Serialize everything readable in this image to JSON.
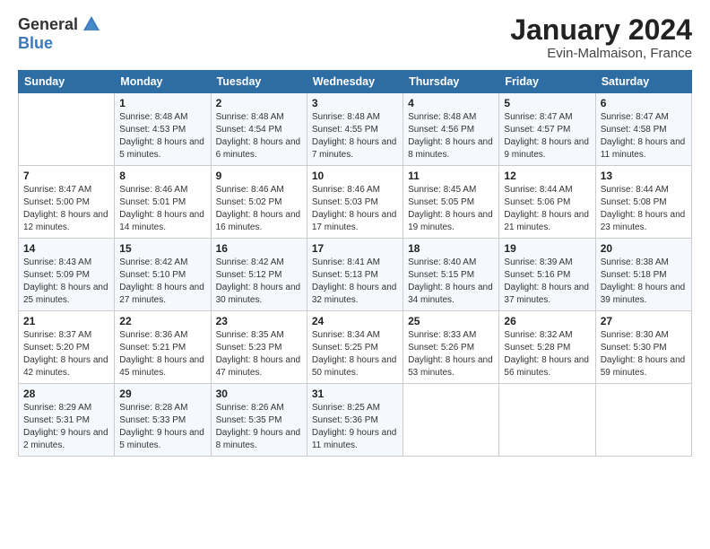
{
  "logo": {
    "general": "General",
    "blue": "Blue"
  },
  "header": {
    "title": "January 2024",
    "subtitle": "Evin-Malmaison, France"
  },
  "weekdays": [
    "Sunday",
    "Monday",
    "Tuesday",
    "Wednesday",
    "Thursday",
    "Friday",
    "Saturday"
  ],
  "weeks": [
    [
      {
        "day": "",
        "sunrise": "",
        "sunset": "",
        "daylight": ""
      },
      {
        "day": "1",
        "sunrise": "Sunrise: 8:48 AM",
        "sunset": "Sunset: 4:53 PM",
        "daylight": "Daylight: 8 hours and 5 minutes."
      },
      {
        "day": "2",
        "sunrise": "Sunrise: 8:48 AM",
        "sunset": "Sunset: 4:54 PM",
        "daylight": "Daylight: 8 hours and 6 minutes."
      },
      {
        "day": "3",
        "sunrise": "Sunrise: 8:48 AM",
        "sunset": "Sunset: 4:55 PM",
        "daylight": "Daylight: 8 hours and 7 minutes."
      },
      {
        "day": "4",
        "sunrise": "Sunrise: 8:48 AM",
        "sunset": "Sunset: 4:56 PM",
        "daylight": "Daylight: 8 hours and 8 minutes."
      },
      {
        "day": "5",
        "sunrise": "Sunrise: 8:47 AM",
        "sunset": "Sunset: 4:57 PM",
        "daylight": "Daylight: 8 hours and 9 minutes."
      },
      {
        "day": "6",
        "sunrise": "Sunrise: 8:47 AM",
        "sunset": "Sunset: 4:58 PM",
        "daylight": "Daylight: 8 hours and 11 minutes."
      }
    ],
    [
      {
        "day": "7",
        "sunrise": "Sunrise: 8:47 AM",
        "sunset": "Sunset: 5:00 PM",
        "daylight": "Daylight: 8 hours and 12 minutes."
      },
      {
        "day": "8",
        "sunrise": "Sunrise: 8:46 AM",
        "sunset": "Sunset: 5:01 PM",
        "daylight": "Daylight: 8 hours and 14 minutes."
      },
      {
        "day": "9",
        "sunrise": "Sunrise: 8:46 AM",
        "sunset": "Sunset: 5:02 PM",
        "daylight": "Daylight: 8 hours and 16 minutes."
      },
      {
        "day": "10",
        "sunrise": "Sunrise: 8:46 AM",
        "sunset": "Sunset: 5:03 PM",
        "daylight": "Daylight: 8 hours and 17 minutes."
      },
      {
        "day": "11",
        "sunrise": "Sunrise: 8:45 AM",
        "sunset": "Sunset: 5:05 PM",
        "daylight": "Daylight: 8 hours and 19 minutes."
      },
      {
        "day": "12",
        "sunrise": "Sunrise: 8:44 AM",
        "sunset": "Sunset: 5:06 PM",
        "daylight": "Daylight: 8 hours and 21 minutes."
      },
      {
        "day": "13",
        "sunrise": "Sunrise: 8:44 AM",
        "sunset": "Sunset: 5:08 PM",
        "daylight": "Daylight: 8 hours and 23 minutes."
      }
    ],
    [
      {
        "day": "14",
        "sunrise": "Sunrise: 8:43 AM",
        "sunset": "Sunset: 5:09 PM",
        "daylight": "Daylight: 8 hours and 25 minutes."
      },
      {
        "day": "15",
        "sunrise": "Sunrise: 8:42 AM",
        "sunset": "Sunset: 5:10 PM",
        "daylight": "Daylight: 8 hours and 27 minutes."
      },
      {
        "day": "16",
        "sunrise": "Sunrise: 8:42 AM",
        "sunset": "Sunset: 5:12 PM",
        "daylight": "Daylight: 8 hours and 30 minutes."
      },
      {
        "day": "17",
        "sunrise": "Sunrise: 8:41 AM",
        "sunset": "Sunset: 5:13 PM",
        "daylight": "Daylight: 8 hours and 32 minutes."
      },
      {
        "day": "18",
        "sunrise": "Sunrise: 8:40 AM",
        "sunset": "Sunset: 5:15 PM",
        "daylight": "Daylight: 8 hours and 34 minutes."
      },
      {
        "day": "19",
        "sunrise": "Sunrise: 8:39 AM",
        "sunset": "Sunset: 5:16 PM",
        "daylight": "Daylight: 8 hours and 37 minutes."
      },
      {
        "day": "20",
        "sunrise": "Sunrise: 8:38 AM",
        "sunset": "Sunset: 5:18 PM",
        "daylight": "Daylight: 8 hours and 39 minutes."
      }
    ],
    [
      {
        "day": "21",
        "sunrise": "Sunrise: 8:37 AM",
        "sunset": "Sunset: 5:20 PM",
        "daylight": "Daylight: 8 hours and 42 minutes."
      },
      {
        "day": "22",
        "sunrise": "Sunrise: 8:36 AM",
        "sunset": "Sunset: 5:21 PM",
        "daylight": "Daylight: 8 hours and 45 minutes."
      },
      {
        "day": "23",
        "sunrise": "Sunrise: 8:35 AM",
        "sunset": "Sunset: 5:23 PM",
        "daylight": "Daylight: 8 hours and 47 minutes."
      },
      {
        "day": "24",
        "sunrise": "Sunrise: 8:34 AM",
        "sunset": "Sunset: 5:25 PM",
        "daylight": "Daylight: 8 hours and 50 minutes."
      },
      {
        "day": "25",
        "sunrise": "Sunrise: 8:33 AM",
        "sunset": "Sunset: 5:26 PM",
        "daylight": "Daylight: 8 hours and 53 minutes."
      },
      {
        "day": "26",
        "sunrise": "Sunrise: 8:32 AM",
        "sunset": "Sunset: 5:28 PM",
        "daylight": "Daylight: 8 hours and 56 minutes."
      },
      {
        "day": "27",
        "sunrise": "Sunrise: 8:30 AM",
        "sunset": "Sunset: 5:30 PM",
        "daylight": "Daylight: 8 hours and 59 minutes."
      }
    ],
    [
      {
        "day": "28",
        "sunrise": "Sunrise: 8:29 AM",
        "sunset": "Sunset: 5:31 PM",
        "daylight": "Daylight: 9 hours and 2 minutes."
      },
      {
        "day": "29",
        "sunrise": "Sunrise: 8:28 AM",
        "sunset": "Sunset: 5:33 PM",
        "daylight": "Daylight: 9 hours and 5 minutes."
      },
      {
        "day": "30",
        "sunrise": "Sunrise: 8:26 AM",
        "sunset": "Sunset: 5:35 PM",
        "daylight": "Daylight: 9 hours and 8 minutes."
      },
      {
        "day": "31",
        "sunrise": "Sunrise: 8:25 AM",
        "sunset": "Sunset: 5:36 PM",
        "daylight": "Daylight: 9 hours and 11 minutes."
      },
      {
        "day": "",
        "sunrise": "",
        "sunset": "",
        "daylight": ""
      },
      {
        "day": "",
        "sunrise": "",
        "sunset": "",
        "daylight": ""
      },
      {
        "day": "",
        "sunrise": "",
        "sunset": "",
        "daylight": ""
      }
    ]
  ]
}
